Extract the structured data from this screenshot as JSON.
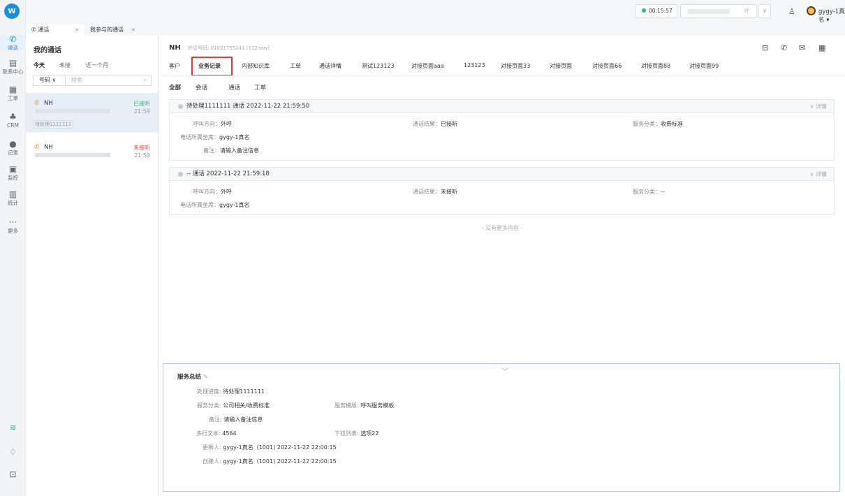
{
  "rail": {
    "logo": "W",
    "items": [
      {
        "icon": "phone-icon",
        "glyph": "✆",
        "label": "通话"
      },
      {
        "icon": "contacts-icon",
        "glyph": "▤",
        "label": "联系中心"
      },
      {
        "icon": "ticket-icon",
        "glyph": "▦",
        "label": "工单"
      },
      {
        "icon": "crm-icon",
        "glyph": "♣",
        "label": "CRM"
      },
      {
        "icon": "record-icon",
        "glyph": "●",
        "label": "记录"
      },
      {
        "icon": "monitor-icon",
        "glyph": "▣",
        "label": "监控"
      },
      {
        "icon": "stats-icon",
        "glyph": "▥",
        "label": "统计"
      },
      {
        "icon": "more-icon",
        "glyph": "···",
        "label": "更多"
      }
    ],
    "bottom": {
      "wifi": "≋",
      "bell": "♢",
      "export": "⊡"
    }
  },
  "topbar": {
    "timer": "00:15:57",
    "number_tag": "呼",
    "dropdown": "∨",
    "user_icon": "♙",
    "username": "gygy-1真名 ▾"
  },
  "call_tabs": [
    {
      "label": "✆ 通话",
      "close": "×"
    },
    {
      "label": "我参与的通话",
      "close": "×"
    }
  ],
  "list": {
    "title": "我的通话",
    "filters": [
      "今天",
      "未接",
      "近一个月"
    ],
    "num_select": "号码 ∨",
    "search_placeholder": "搜索",
    "search_icon": "⌕",
    "items": [
      {
        "name": "NH",
        "status": "已接听",
        "status_color": "#2dbd6e",
        "time": "21:59",
        "tag": "待处理1111111"
      },
      {
        "name": "NH",
        "status": "未接听",
        "status_color": "#f04b4b",
        "time": "21:59",
        "tag": ""
      }
    ]
  },
  "main": {
    "customer_name": "NH",
    "customer_sub": "外显号码: 01021755241 (112new)",
    "tabs": [
      "客户",
      "业务记录",
      "内部知识库",
      "工单",
      "通话详情",
      "测试123123",
      "对接页面aaa",
      "123123",
      "对接页面33",
      "对接页面",
      "对接页面66",
      "对接页面88",
      "对接页面99"
    ],
    "sub_tabs": [
      "全部",
      "会话",
      "通话",
      "工单"
    ],
    "records": [
      {
        "header": "待处理1111111  通话  2022-11-22 21:59:50",
        "detail": "∨ 详情",
        "fields": [
          {
            "k": "呼叫方向：",
            "v": "外呼"
          },
          {
            "k": "通话结果：",
            "v": "已接听"
          },
          {
            "k": "服务分类：",
            "v": "收费标准"
          },
          {
            "k": "电话所属坐席：",
            "v": "gygy-1真名"
          },
          {
            "k": "备注：",
            "v": "请输入备注信息"
          }
        ]
      },
      {
        "header": "--  通话  2022-11-22 21:59:18",
        "detail": "∨ 详情",
        "fields": [
          {
            "k": "呼叫方向：",
            "v": "外呼"
          },
          {
            "k": "通话结果：",
            "v": "未接听"
          },
          {
            "k": "服务分类：",
            "v": "--"
          },
          {
            "k": "电话所属坐席：",
            "v": "gygy-1真名"
          }
        ]
      }
    ],
    "no_more": "- 没有更多内容 -",
    "summary": {
      "title": "服务总结",
      "chevron": "﹀",
      "fields": [
        {
          "k": "处理进度:",
          "v": "待处理1111111"
        },
        {
          "k": "服务分类:",
          "v": "公司相关/收费标准"
        },
        {
          "k": "服务模版:",
          "v": "呼叫服务模板"
        },
        {
          "k": "备注:",
          "v": "请输入备注信息"
        },
        {
          "k": "多行文本:",
          "v": "4564"
        },
        {
          "k": "下拉列表:",
          "v": "选项22"
        },
        {
          "k": "更新人:",
          "v": " gygy-1真名（1001) 2022-11-22 22:00:15"
        },
        {
          "k": "创建人:",
          "v": " gygy-1真名（1001) 2022-11-22 22:00:15"
        }
      ]
    }
  }
}
